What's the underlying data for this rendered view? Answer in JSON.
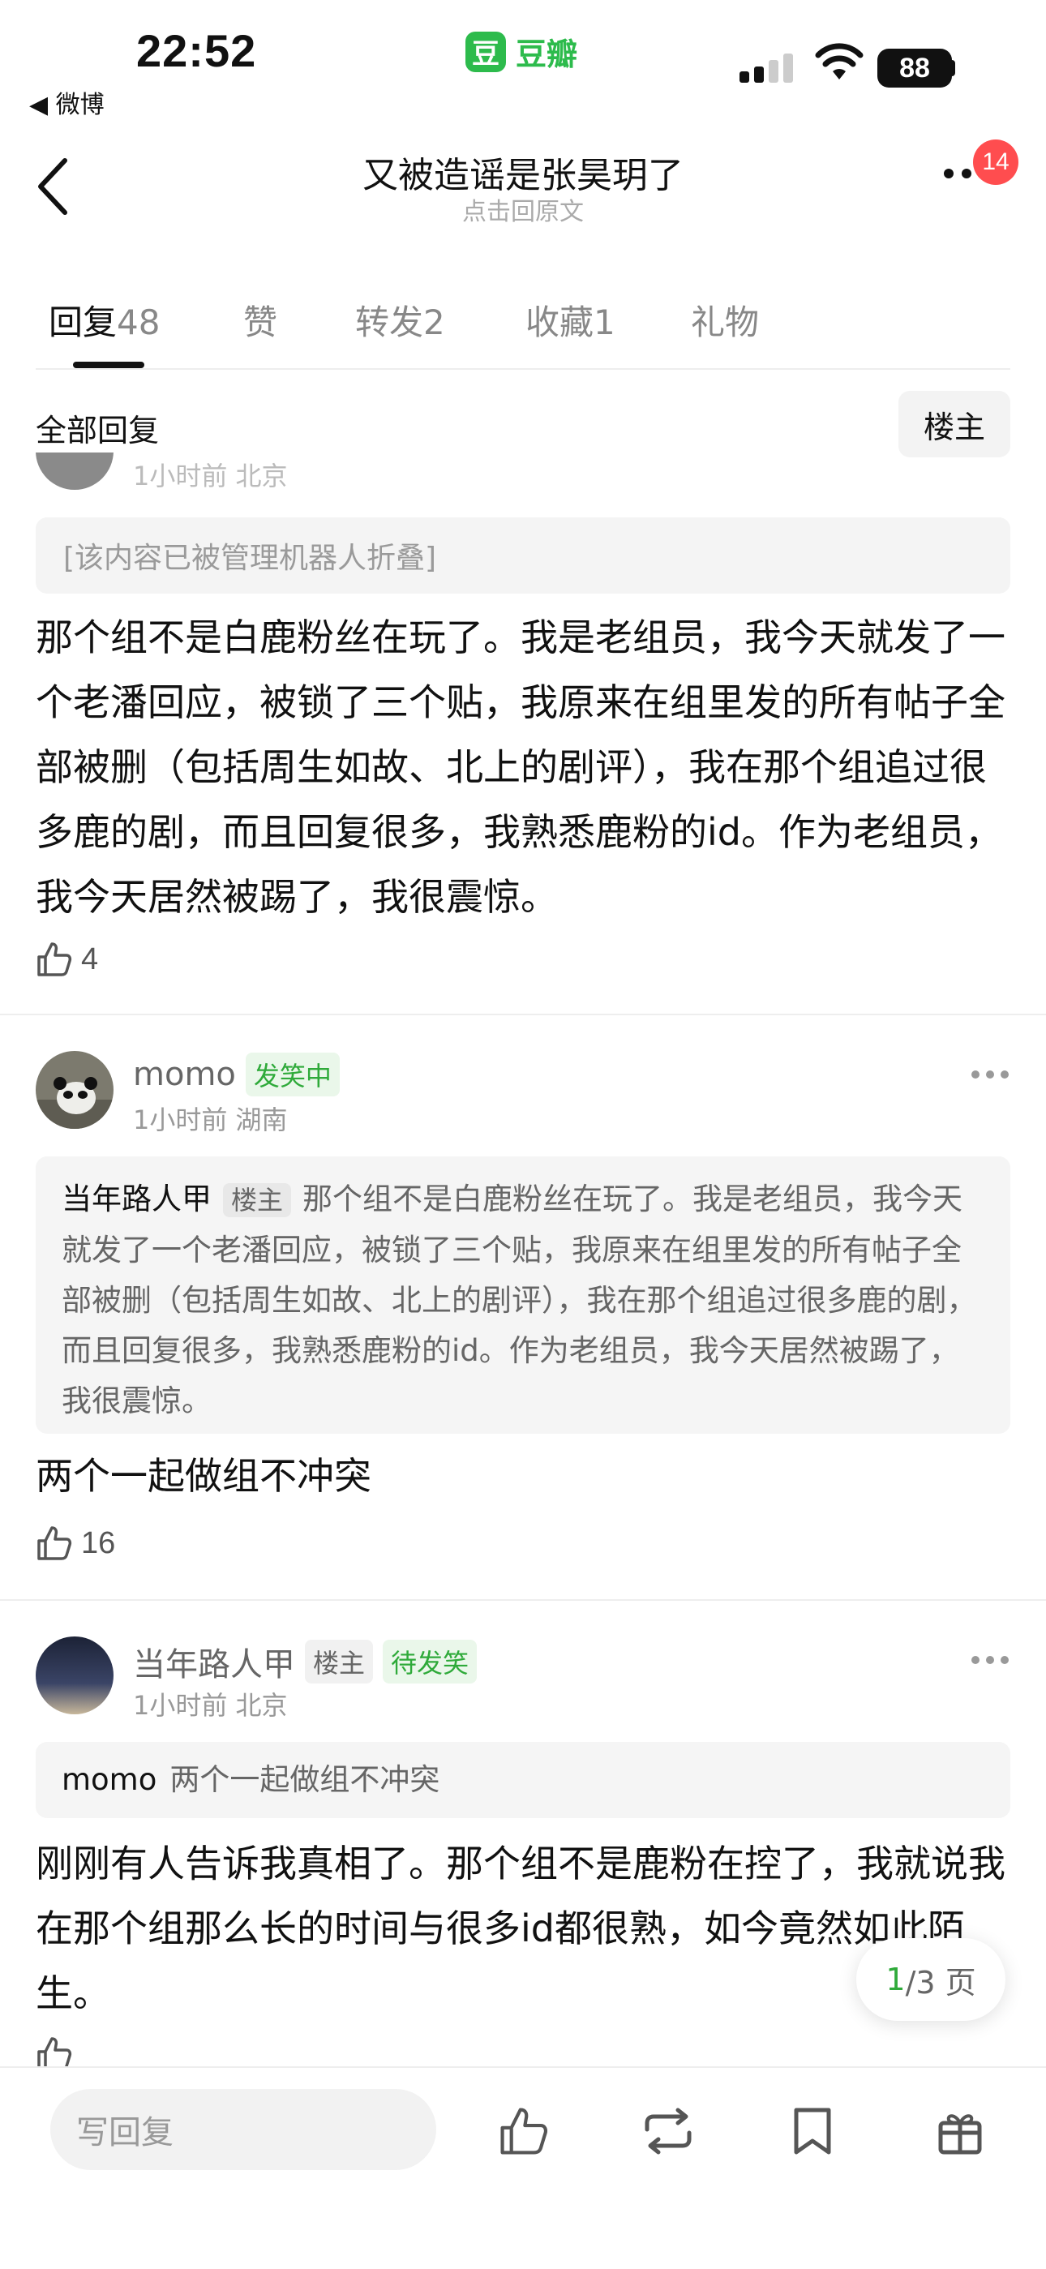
{
  "status_bar": {
    "time": "22:52",
    "back_app": "◀ 微博",
    "app_logo": "豆",
    "app_name": "豆瓣",
    "battery": "88"
  },
  "nav": {
    "title": "又被造谣是张昊玥了",
    "subtitle": "点击回原文",
    "badge": "14"
  },
  "tabs": [
    {
      "label": "回复",
      "count": "48"
    },
    {
      "label": "赞",
      "count": ""
    },
    {
      "label": "转发",
      "count": "2"
    },
    {
      "label": "收藏",
      "count": "1"
    },
    {
      "label": "礼物",
      "count": ""
    }
  ],
  "filter": {
    "label": "全部回复",
    "button": "楼主"
  },
  "post0": {
    "meta_partial": "1小时前 北京",
    "folded": "[该内容已被管理机器人折叠]",
    "text": "那个组不是白鹿粉丝在玩了。我是老组员，我今天就发了一个老潘回应，被锁了三个贴，我原来在组里发的所有帖子全部被删（包括周生如故、北上的剧评），我在那个组追过很多鹿的剧，而且回复很多，我熟悉鹿粉的id。作为老组员，我今天居然被踢了，我很震惊。",
    "likes": "4"
  },
  "post1": {
    "author": "momo",
    "status_tag": "发笑中",
    "meta": "1小时前 湖南",
    "quote_author": "当年路人甲",
    "quote_tag": "楼主",
    "quote_text": "那个组不是白鹿粉丝在玩了。我是老组员，我今天就发了一个老潘回应，被锁了三个贴，我原来在组里发的所有帖子全部被删（包括周生如故、北上的剧评），我在那个组追过很多鹿的剧，而且回复很多，我熟悉鹿粉的id。作为老组员，我今天居然被踢了，我很震惊。",
    "text": "两个一起做组不冲突",
    "likes": "16"
  },
  "post2": {
    "author": "当年路人甲",
    "owner_tag": "楼主",
    "status_tag": "待发笑",
    "meta": "1小时前 北京",
    "quote_author": "momo",
    "quote_text": "两个一起做组不冲突",
    "text": "刚刚有人告诉我真相了。那个组不是鹿粉在控了，我就说我在那个组那么长的时间与很多id都很熟，如今竟然如此陌生。"
  },
  "pager": {
    "current": "1",
    "total": "/3 页"
  },
  "bottom_bar": {
    "reply_placeholder": "写回复"
  },
  "icons": [
    "back-arrow-icon",
    "more-icon",
    "like-icon",
    "repost-icon",
    "bookmark-icon",
    "gift-icon",
    "wifi-icon",
    "signal-icon"
  ],
  "colors": {
    "brand_green": "#2dbb4c",
    "badge_red": "#ff4d4f",
    "tag_green_text": "#2faa3a"
  }
}
